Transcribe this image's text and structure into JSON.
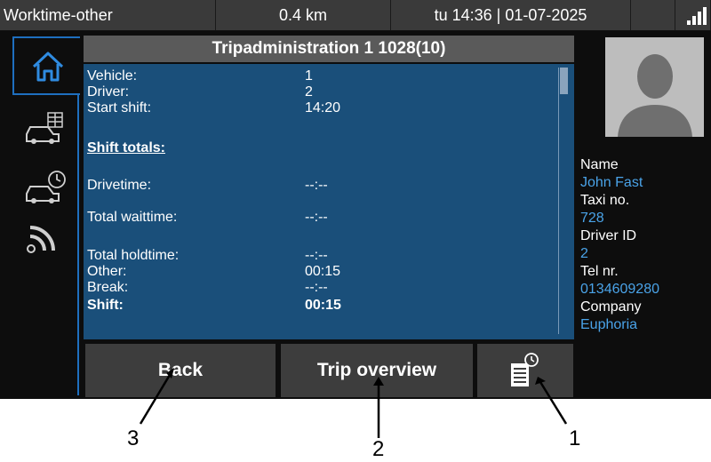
{
  "status_bar": {
    "mode": "Worktime-other",
    "distance": "0.4 km",
    "datetime": "tu 14:36 | 01-07-2025"
  },
  "nav": {
    "items": [
      {
        "icon": "home-icon"
      },
      {
        "icon": "car-list-icon"
      },
      {
        "icon": "car-clock-icon"
      },
      {
        "icon": "signal-icon"
      }
    ]
  },
  "main": {
    "title": "Tripadministration 1 1028(10)",
    "rows": [
      {
        "label": "Vehicle:",
        "value": "1"
      },
      {
        "label": "Driver:",
        "value": "2"
      },
      {
        "label": "Start shift:",
        "value": "14:20"
      }
    ],
    "section_title": "Shift totals:",
    "totals": [
      {
        "label": "Drivetime:",
        "value": "--:--"
      },
      {
        "label": "Total waittime:",
        "value": "--:--"
      },
      {
        "label": "Total holdtime:",
        "value": "--:--"
      },
      {
        "label": "Other:",
        "value": "00:15"
      },
      {
        "label": "Break:",
        "value": "--:--"
      },
      {
        "label": "Shift:",
        "value": "00:15"
      }
    ]
  },
  "buttons": {
    "back": "Back",
    "trip_overview": "Trip overview",
    "print_icon": "document-clock-icon"
  },
  "driver": {
    "name_label": "Name",
    "name": "John Fast",
    "taxi_label": "Taxi no.",
    "taxi": "728",
    "driver_id_label": "Driver ID",
    "driver_id": "2",
    "tel_label": "Tel nr.",
    "tel": "0134609280",
    "company_label": "Company",
    "company": "Euphoria"
  },
  "annotations": {
    "n1": "1",
    "n2": "2",
    "n3": "3"
  },
  "colors": {
    "accent": "#1e6fbf",
    "content_bg": "#1a4f7a",
    "value_text": "#4aa3e8",
    "button_bg": "#3d3d3d"
  }
}
